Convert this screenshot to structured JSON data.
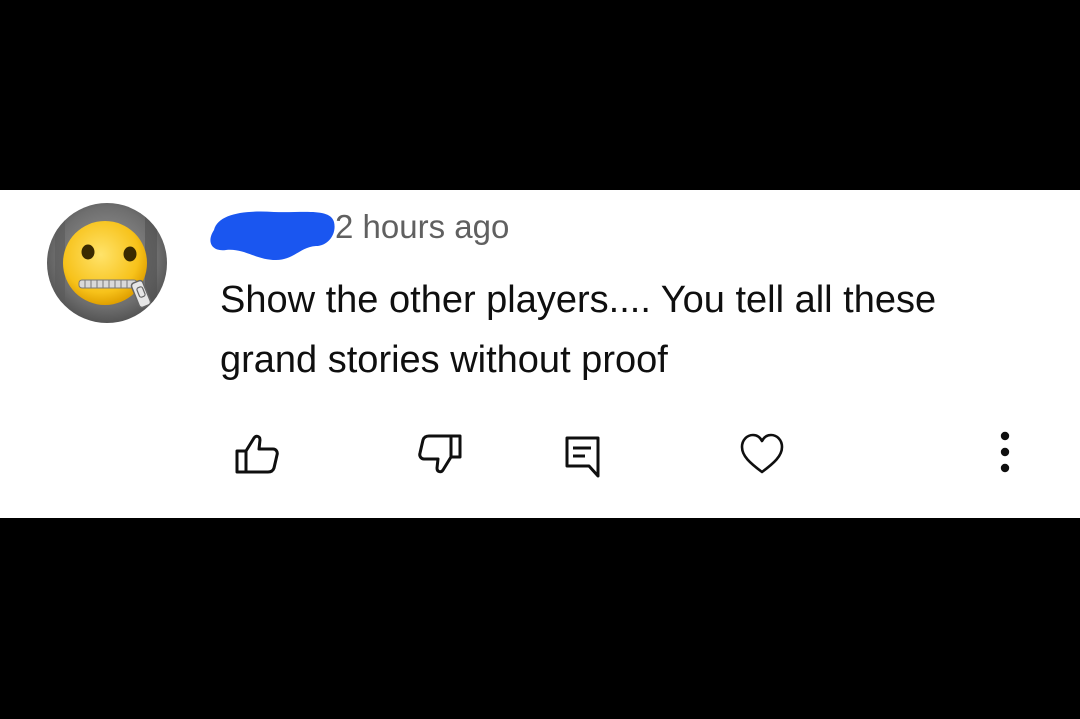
{
  "comment": {
    "author": "",
    "timestamp": "2 hours ago",
    "text": "Show the other players.... You tell all these grand stories without proof",
    "avatar_icon": "zipper-mouth-face-icon",
    "author_redaction_color": "#1a56f0"
  },
  "actions": [
    {
      "name": "like",
      "icon": "thumbs-up-icon"
    },
    {
      "name": "dislike",
      "icon": "thumbs-down-icon"
    },
    {
      "name": "reply",
      "icon": "reply-comment-icon"
    },
    {
      "name": "heart",
      "icon": "heart-icon"
    },
    {
      "name": "more",
      "icon": "more-vertical-icon"
    }
  ],
  "colors": {
    "background": "#ffffff",
    "letterbox": "#000000",
    "text_primary": "#0f0f0f",
    "text_secondary": "#606060"
  }
}
